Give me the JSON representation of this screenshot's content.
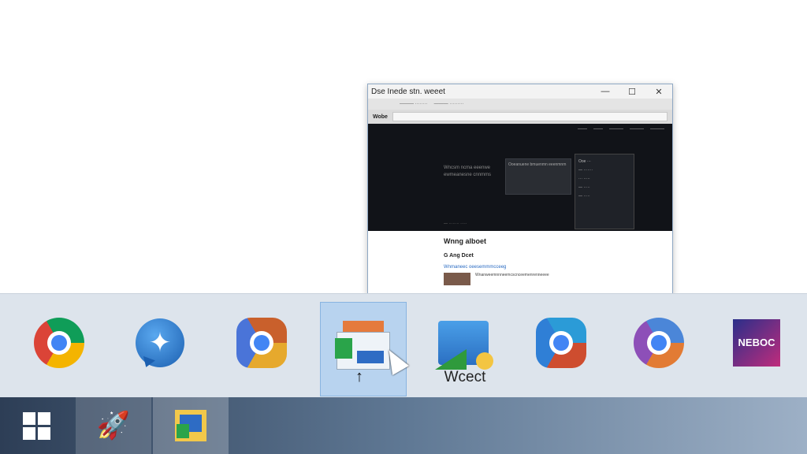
{
  "preview_window": {
    "title": "Dse Inede stn. weeet",
    "controls": {
      "minimize": "—",
      "maximize": "☐",
      "close": "✕"
    },
    "tabs": [
      "——— ········",
      "——— ·········"
    ],
    "site_name": "Wobe",
    "address": "",
    "dark_section": {
      "nav": [
        "——",
        "——",
        "———",
        "———",
        "———"
      ],
      "hero_text": "Wncsm ncma eeenwe ewmeanesne cnnmms",
      "card_text": "Ooeanuene bmuenmn eeenmnm",
      "panel_lines": [
        "Ooe ···",
        "— ·······",
        "··· ·····",
        "— ·····",
        "— ·····"
      ],
      "footer": "— ········ ·····"
    },
    "heading": "Wnng alboet",
    "subheading": "G Ang Dcet",
    "link": "Wnmaneec oeesemmmcceeg",
    "description": "Wnanweemnnneemcscnceemenrenneeee"
  },
  "icon_strip": {
    "active_slot": 3,
    "active_caption": "Wcect",
    "colors": {
      "strip_bg": "#dde4ec",
      "active_bg": "#b8d3ef"
    },
    "slots": [
      {
        "name": "chrome-icon"
      },
      {
        "name": "messenger-icon",
        "glyph": "✦"
      },
      {
        "name": "chrome-variant-icon"
      },
      {
        "name": "app-window-icon"
      },
      {
        "name": "widget-icon"
      },
      {
        "name": "chrome-variant-icon"
      },
      {
        "name": "chrome-icon"
      },
      {
        "name": "nebox-icon",
        "label": "NEBOC"
      }
    ],
    "up_arrow": "↑"
  },
  "taskbar": {
    "start_icon": "windows-logo-icon",
    "pinned": [
      {
        "name": "rocket-app-icon",
        "glyph": "🚀"
      },
      {
        "name": "widget-app-icon"
      }
    ]
  }
}
